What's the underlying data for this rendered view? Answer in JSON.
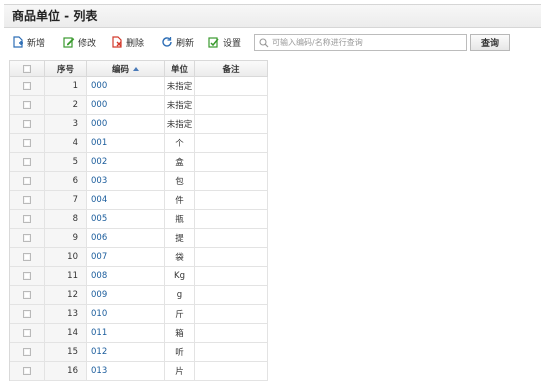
{
  "title": "商品单位 - 列表",
  "toolbar": {
    "add_label": "新增",
    "edit_label": "修改",
    "delete_label": "删除",
    "refresh_label": "刷新",
    "settings_label": "设置",
    "search_placeholder": "可输入编码/名称进行查询",
    "query_label": "查询"
  },
  "colors": {
    "add": "#2f6fb6",
    "edit": "#3a9a2e",
    "delete": "#d33a2c",
    "refresh": "#2f6fb6",
    "settings": "#3a9a2e",
    "code_link": "#1a5c9c"
  },
  "table": {
    "headers": {
      "seq": "序号",
      "code": "编码",
      "unit": "单位",
      "note": "备注"
    },
    "sort": {
      "column": "code",
      "direction": "ascending"
    },
    "rows": [
      {
        "seq": "1",
        "code": "000",
        "unit": "未指定",
        "note": ""
      },
      {
        "seq": "2",
        "code": "000",
        "unit": "未指定",
        "note": ""
      },
      {
        "seq": "3",
        "code": "000",
        "unit": "未指定",
        "note": ""
      },
      {
        "seq": "4",
        "code": "001",
        "unit": "个",
        "note": ""
      },
      {
        "seq": "5",
        "code": "002",
        "unit": "盒",
        "note": ""
      },
      {
        "seq": "6",
        "code": "003",
        "unit": "包",
        "note": ""
      },
      {
        "seq": "7",
        "code": "004",
        "unit": "件",
        "note": ""
      },
      {
        "seq": "8",
        "code": "005",
        "unit": "瓶",
        "note": ""
      },
      {
        "seq": "9",
        "code": "006",
        "unit": "提",
        "note": ""
      },
      {
        "seq": "10",
        "code": "007",
        "unit": "袋",
        "note": ""
      },
      {
        "seq": "11",
        "code": "008",
        "unit": "Kg",
        "note": ""
      },
      {
        "seq": "12",
        "code": "009",
        "unit": "g",
        "note": ""
      },
      {
        "seq": "13",
        "code": "010",
        "unit": "斤",
        "note": ""
      },
      {
        "seq": "14",
        "code": "011",
        "unit": "箱",
        "note": ""
      },
      {
        "seq": "15",
        "code": "012",
        "unit": "听",
        "note": ""
      },
      {
        "seq": "16",
        "code": "013",
        "unit": "片",
        "note": ""
      }
    ]
  }
}
